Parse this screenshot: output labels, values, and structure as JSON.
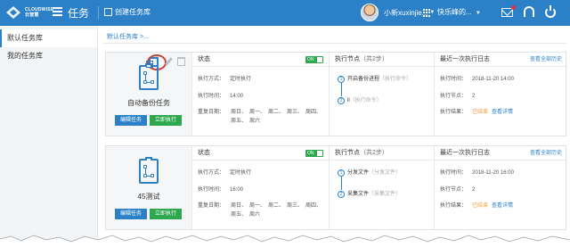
{
  "topbar": {
    "logo_line1": "CLOUDWISE",
    "logo_line2": "云智慧",
    "title": "任务",
    "create_label": "创建任务库",
    "user_name": "小新xuxinjie...",
    "team_name": "快乐峰的...",
    "icons": [
      "menu-icon",
      "grid-icon",
      "mail-icon",
      "headset-icon",
      "power-icon"
    ]
  },
  "sidebar": {
    "items": [
      {
        "label": "默认任务库",
        "active": true
      },
      {
        "label": "我的任务库",
        "active": false
      }
    ]
  },
  "breadcrumb": "默认任务库 >...",
  "columns": {
    "status": "状态",
    "nodes": "执行节点",
    "nodes_count": "（共2步）",
    "log": "最近一次执行日志",
    "log_link": "查看全部历史"
  },
  "cards": [
    {
      "name": "自动备份任务",
      "edit_label": "编辑任务",
      "run_label": "立即执行",
      "toggle": "ON",
      "mode_key": "执行方式：",
      "mode_val": "定时执行",
      "time_key": "执行时间：",
      "time_val": "14:00",
      "repeat_key": "重复日期：",
      "days": [
        "周日、",
        "周一、",
        "周二、",
        "周三、",
        "周四、",
        "周五、",
        "周六"
      ],
      "nodes": [
        {
          "num": "1",
          "label": "开启备份进程",
          "hint": "（执行命令）"
        },
        {
          "num": "2",
          "label": "ll",
          "hint": "（执行命令）"
        }
      ],
      "log_time_key": "执行时间：",
      "log_time_val": "2018-11-20 14:00",
      "log_node_key": "执行节点：",
      "log_node_val": "2",
      "log_result_key": "执行结果：",
      "log_result_val": "已结束",
      "log_detail": "查看详情"
    },
    {
      "name": "45测试",
      "edit_label": "编辑任务",
      "run_label": "立即执行",
      "toggle": "ON",
      "mode_key": "执行方式：",
      "mode_val": "定时执行",
      "time_key": "执行时间：",
      "time_val": "16:00",
      "repeat_key": "重复日期：",
      "days": [
        "周日、",
        "周一、",
        "周二、",
        "周三、",
        "周四、",
        "周五、",
        "周六"
      ],
      "nodes": [
        {
          "num": "1",
          "label": "分发文件",
          "hint": "（分发文件）"
        },
        {
          "num": "2",
          "label": "采集文件",
          "hint": "（采集文件）"
        }
      ],
      "log_time_key": "执行时间：",
      "log_time_val": "2018-11-20 16:00",
      "log_node_key": "执行节点：",
      "log_node_val": "2",
      "log_result_key": "执行结果：",
      "log_result_val": "已结束",
      "log_detail": "查看详情"
    }
  ]
}
